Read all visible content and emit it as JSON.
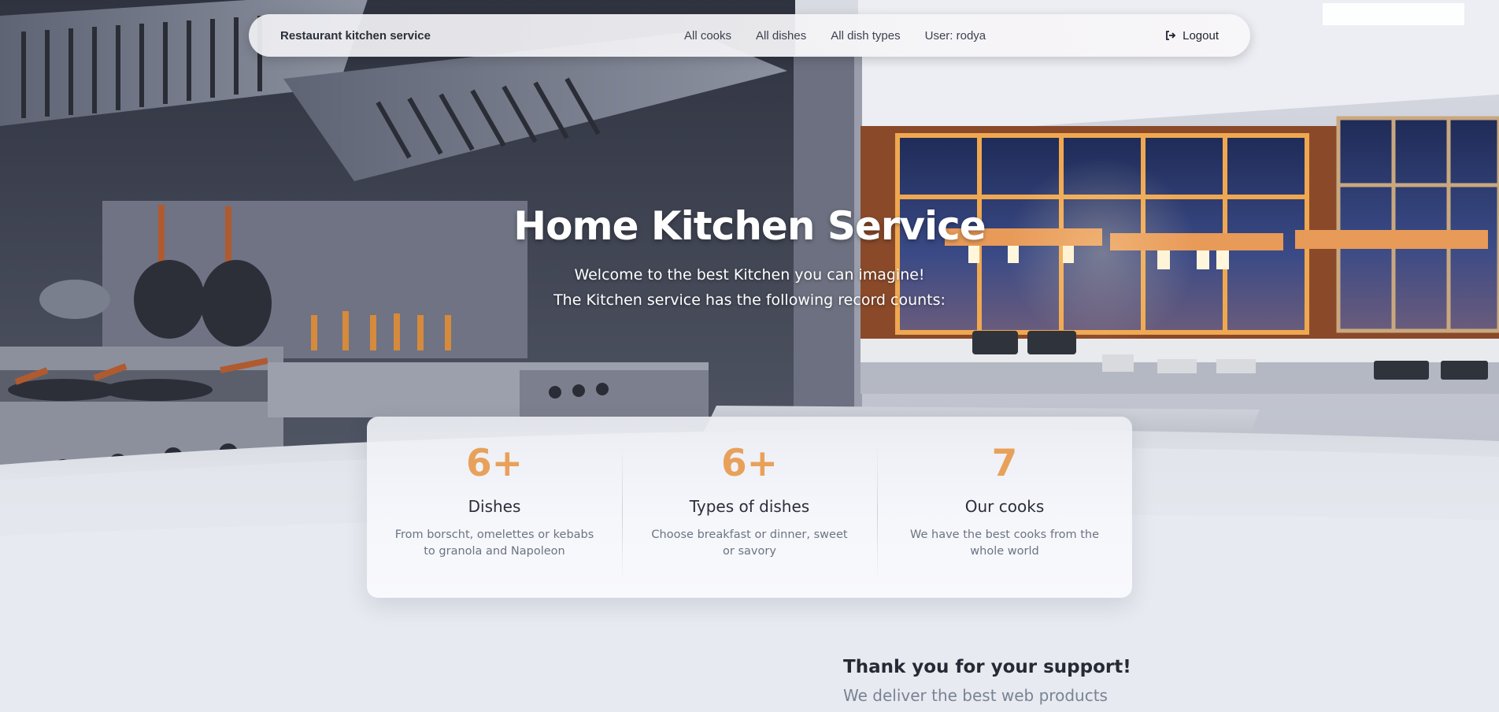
{
  "navbar": {
    "brand": "Restaurant kitchen service",
    "links": [
      {
        "label": "All cooks"
      },
      {
        "label": "All dishes"
      },
      {
        "label": "All dish types"
      }
    ],
    "user": "User: rodya",
    "logout_label": "Logout",
    "logout_icon": "sign-out-icon"
  },
  "hero": {
    "title": "Home Kitchen Service",
    "subtitle_line1": "Welcome to the best Kitchen you can imagine!",
    "subtitle_line2": "The Kitchen service has the following record counts:"
  },
  "stats": [
    {
      "value": "6+",
      "title": "Dishes",
      "description": "From borscht, omelettes or kebabs to granola and Napoleon"
    },
    {
      "value": "6+",
      "title": "Types of dishes",
      "description": "Choose breakfast or dinner, sweet or savory"
    },
    {
      "value": "7",
      "title": "Our cooks",
      "description": "We have the best cooks from the whole world"
    }
  ],
  "support": {
    "title": "Thank you for your support!",
    "subtitle": "We deliver the best web products"
  },
  "colors": {
    "accent": "#e8a15a",
    "page_bg": "#e7eaf0",
    "text_dark": "#2a2f3a",
    "text_muted": "#6b7484"
  }
}
